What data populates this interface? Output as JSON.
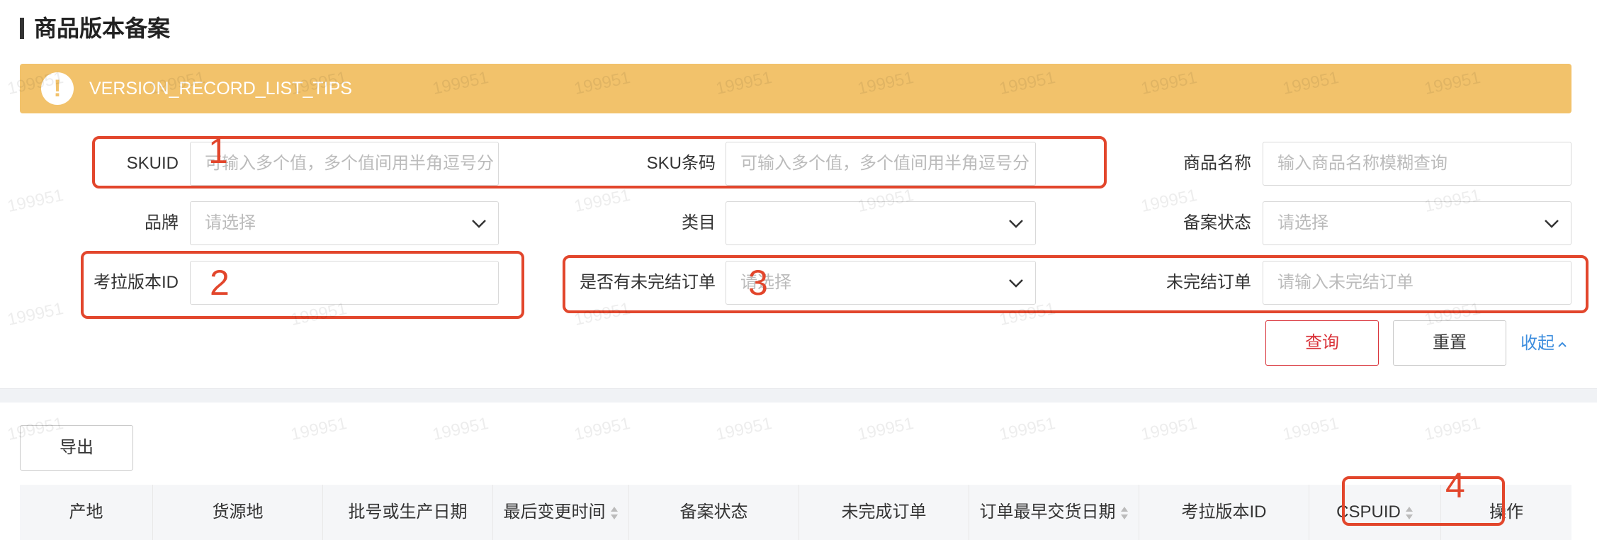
{
  "page": {
    "title": "商品版本备案"
  },
  "tips": {
    "text": "VERSION_RECORD_LIST_TIPS",
    "icon": "exclamation-icon",
    "color": "#f2c26b"
  },
  "filters": {
    "skuid": {
      "label": "SKUID",
      "placeholder": "可输入多个值，多个值间用半角逗号分"
    },
    "sku_barcode": {
      "label": "SKU条码",
      "placeholder": "可输入多个值，多个值间用半角逗号分"
    },
    "product_name": {
      "label": "商品名称",
      "placeholder": "输入商品名称模糊查询"
    },
    "brand": {
      "label": "品牌",
      "placeholder": "请选择"
    },
    "category": {
      "label": "类目",
      "placeholder": ""
    },
    "record_status": {
      "label": "备案状态",
      "placeholder": "请选择"
    },
    "kaola_version_id": {
      "label": "考拉版本ID",
      "placeholder": ""
    },
    "has_unfinished_order": {
      "label": "是否有未完结订单",
      "placeholder": "请选择"
    },
    "unfinished_order": {
      "label": "未完结订单",
      "placeholder": "请输入未完结订单"
    }
  },
  "actions": {
    "query": "查询",
    "reset": "重置",
    "collapse": "收起",
    "export": "导出"
  },
  "table": {
    "columns": [
      "产地",
      "货源地",
      "批号或生产日期",
      "最后变更时间",
      "备案状态",
      "未完成订单",
      "订单最早交货日期",
      "考拉版本ID",
      "CSPUID",
      "操作"
    ]
  },
  "annotations": [
    "1",
    "2",
    "3",
    "4"
  ],
  "watermark": "199951",
  "colors": {
    "accent_red": "#d9333a",
    "annotation_red": "#e2462c",
    "link_blue": "#3c8dde"
  }
}
